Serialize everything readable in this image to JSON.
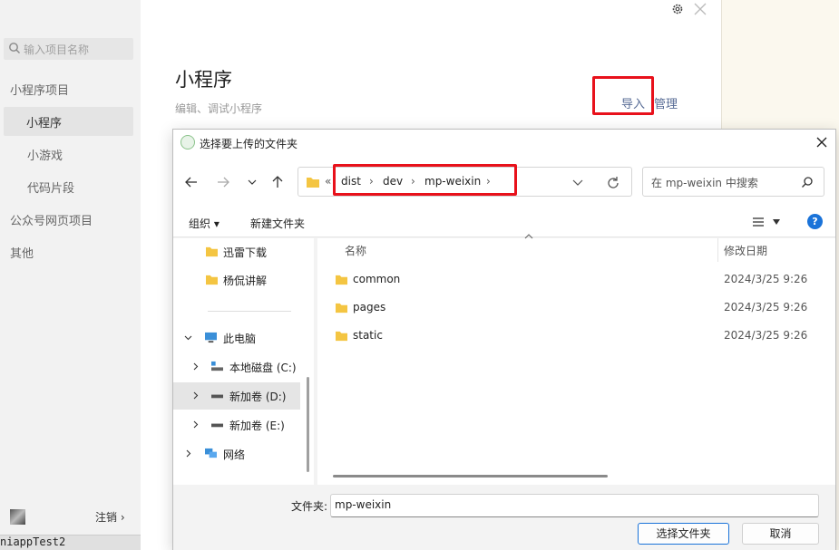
{
  "sidebar": {
    "search_placeholder": "输入项目名称",
    "items": [
      {
        "label": "小程序项目"
      },
      {
        "label": "小程序"
      },
      {
        "label": "小游戏"
      },
      {
        "label": "代码片段"
      },
      {
        "label": "公众号网页项目"
      },
      {
        "label": "其他"
      }
    ],
    "logout_label": "注销 ›"
  },
  "statusbar": {
    "text": "niappTest2"
  },
  "main": {
    "title": "小程序",
    "subtitle": "编辑、调试小程序",
    "import_label": "导入",
    "manage_label": "管理"
  },
  "dialog": {
    "title": "选择要上传的文件夹",
    "breadcrumb": {
      "overflow": "«",
      "items": [
        "dist",
        "dev",
        "mp-weixin"
      ]
    },
    "search_placeholder": "在 mp-weixin 中搜索",
    "toolbar": {
      "organize": "组织 ▾",
      "new_folder": "新建文件夹",
      "help": "?"
    },
    "tree": [
      {
        "label": "迅雷下载"
      },
      {
        "label": "杨侃讲解"
      },
      {
        "label": "此电脑"
      },
      {
        "label": "本地磁盘 (C:)"
      },
      {
        "label": "新加卷 (D:)"
      },
      {
        "label": "新加卷 (E:)"
      },
      {
        "label": "网络"
      }
    ],
    "columns": {
      "name": "名称",
      "date": "修改日期"
    },
    "files": [
      {
        "name": "common",
        "date": "2024/3/25 9:26"
      },
      {
        "name": "pages",
        "date": "2024/3/25 9:26"
      },
      {
        "name": "static",
        "date": "2024/3/25 9:26"
      }
    ],
    "folder_label": "文件夹:",
    "folder_value": "mp-weixin",
    "ok_label": "选择文件夹",
    "cancel_label": "取消"
  },
  "colors": {
    "accent": "#1a73d9",
    "highlight": "#e8111b",
    "link": "#576b95",
    "folder": "#f4c542"
  }
}
